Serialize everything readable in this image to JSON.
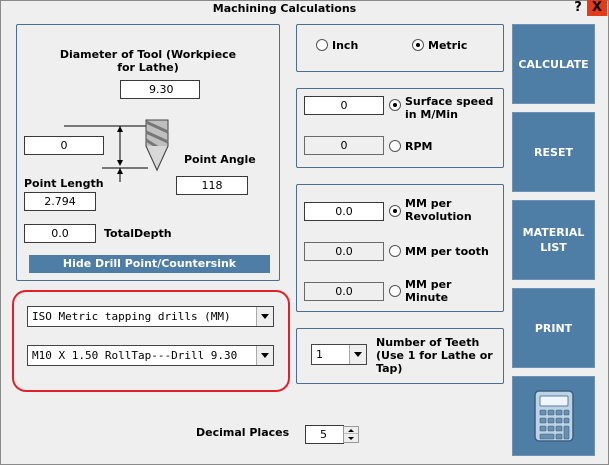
{
  "window": {
    "title": "Machining Calculations",
    "help": "?",
    "close": "X"
  },
  "tool_panel": {
    "diameter_label": "Diameter of Tool (Workpiece for Lathe)",
    "diameter_value": "9.30",
    "left_value": "0",
    "point_angle_label": "Point Angle",
    "point_angle_value": "118",
    "point_length_label": "Point Length",
    "point_length_value": "2.794",
    "total_depth_value": "0.0",
    "total_depth_label": "TotalDepth",
    "hide_button": "Hide Drill Point/Countersink"
  },
  "units": {
    "inch": "Inch",
    "metric": "Metric",
    "selected": "metric"
  },
  "speed": {
    "surface_value": "0",
    "surface_label": "Surface speed in M/Min",
    "rpm_value": "0",
    "rpm_label": "RPM",
    "selected": "surface"
  },
  "feed": {
    "per_rev_value": "0.0",
    "per_rev_label": "MM per Revolution",
    "per_tooth_value": "0.0",
    "per_tooth_label": "MM per tooth",
    "per_min_value": "0.0",
    "per_min_label": "MM per Minute",
    "selected": "per_rev"
  },
  "teeth": {
    "value": "1",
    "label": "Number of Teeth (Use 1 for Lathe or Tap)"
  },
  "selectors": {
    "category": "ISO Metric tapping drills (MM)",
    "item": "M10 X 1.50 RollTap---Drill 9.30"
  },
  "decimal": {
    "label": "Decimal Places",
    "value": "5"
  },
  "buttons": {
    "calculate": "CALCULATE",
    "reset": "RESET",
    "material": "MATERIAL LIST",
    "print": "PRINT"
  },
  "colors": {
    "accent": "#4e7ea6",
    "highlight": "#e0212b",
    "close": "#e13b1b"
  },
  "icons": {
    "drill": "drill-bit-icon",
    "calculator": "calculator-icon"
  }
}
